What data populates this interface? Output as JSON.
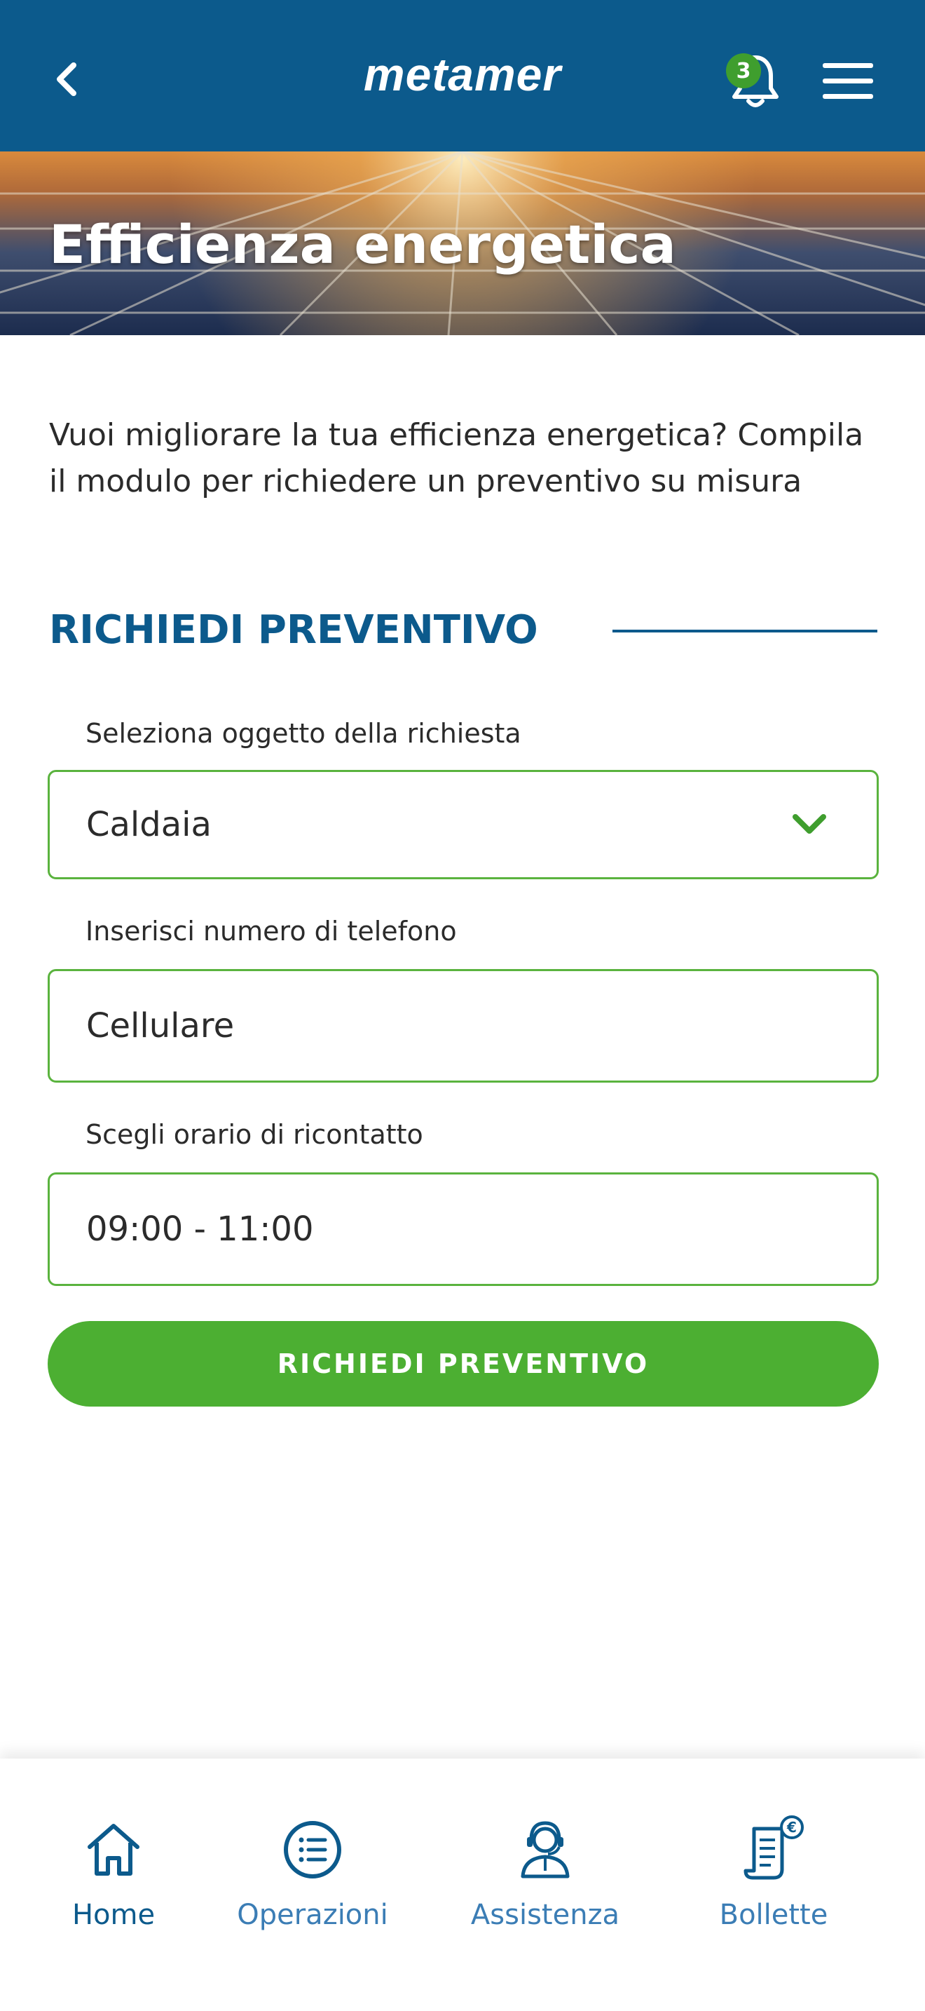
{
  "header": {
    "logo": "metamer",
    "notifications_count": "3"
  },
  "hero": {
    "title": "Efficienza energetica"
  },
  "intro": {
    "text": "Vuoi migliorare la tua efficienza energetica? Compila il modulo per richiedere un preventivo su misura"
  },
  "form": {
    "section_title": "RICHIEDI PREVENTIVO",
    "subject_label": "Seleziona oggetto della richiesta",
    "subject_value": "Caldaia",
    "phone_label": "Inserisci numero di telefono",
    "phone_value": "Cellulare",
    "time_label": "Scegli orario di ricontatto",
    "time_value": "09:00 - 11:00",
    "submit_label": "RICHIEDI PREVENTIVO"
  },
  "tabbar": {
    "items": [
      {
        "label": "Home",
        "icon": "home-icon"
      },
      {
        "label": "Operazioni",
        "icon": "list-icon"
      },
      {
        "label": "Assistenza",
        "icon": "support-agent-icon"
      },
      {
        "label": "Bollette",
        "icon": "bill-euro-icon"
      }
    ]
  },
  "colors": {
    "primary": "#0c5a8c",
    "accent": "#4caf32",
    "field_border": "#5ab33e"
  }
}
